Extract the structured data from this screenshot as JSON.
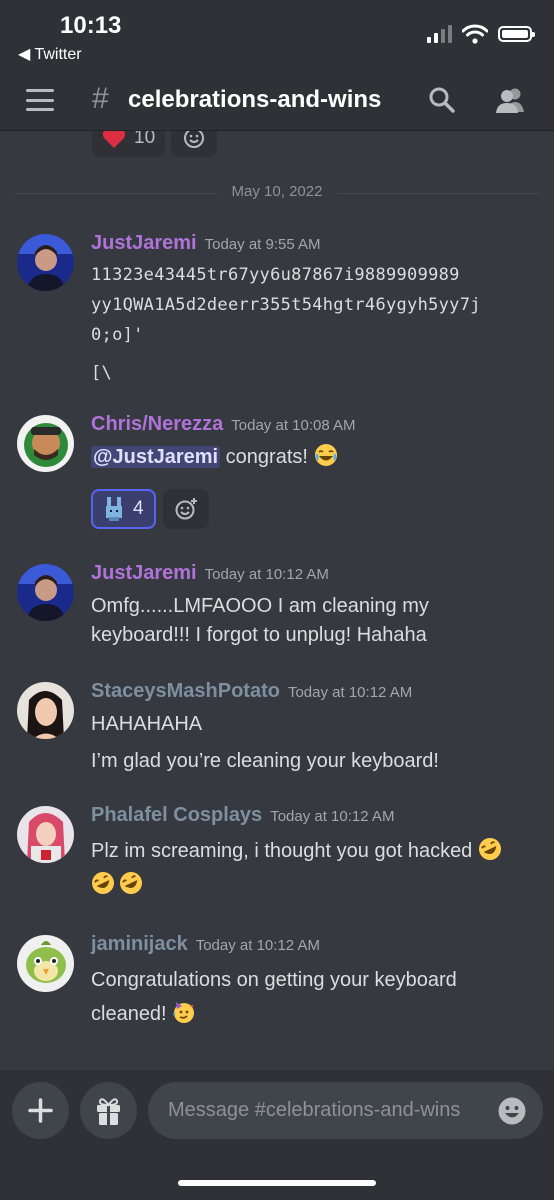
{
  "status_bar": {
    "time": "10:13",
    "back_label": "Twitter"
  },
  "header": {
    "hash": "#",
    "channel": "celebrations-and-wins"
  },
  "top_reactions": [
    {
      "emoji": "heart",
      "count": "10"
    }
  ],
  "date_divider": "May 10, 2022",
  "messages": [
    {
      "author": "JustJaremi",
      "color": "#b073d9",
      "time": "Today at 9:55 AM",
      "lines": [
        "11323e43445tr67yy6u87867i9889909989",
        "yy1QWA1A5d2deerr355t54hgtr46ygyh5yy7j",
        "0;o]'",
        "[\\"
      ]
    },
    {
      "author": "Chris/Nerezza",
      "color": "#b073d9",
      "time": "Today at 10:08 AM",
      "mention": "@JustJaremi",
      "text": " congrats! ",
      "reaction": {
        "emoji": "pixel-bunny",
        "count": "4"
      }
    },
    {
      "author": "JustJaremi",
      "color": "#b073d9",
      "time": "Today at 10:12 AM",
      "text": "Omfg......LMFAOOO I am cleaning my keyboard!!! I forgot to unplug! Hahaha"
    },
    {
      "author": "StaceysMashPotato",
      "color": "#7e8fa0",
      "time": "Today at 10:12 AM",
      "lines": [
        "HAHAHAHA",
        "I’m glad you’re cleaning your keyboard!"
      ]
    },
    {
      "author": "Phalafel Cosplays",
      "color": "#7e8fa0",
      "time": "Today at 10:12 AM",
      "text": "Plz im screaming, i thought you got hacked "
    },
    {
      "author": "jaminijack",
      "color": "#7e8fa0",
      "time": "Today at 10:12 AM",
      "text": "Congratulations on getting your keyboard cleaned! "
    }
  ],
  "composer": {
    "placeholder": "Message #celebrations-and-wins"
  }
}
